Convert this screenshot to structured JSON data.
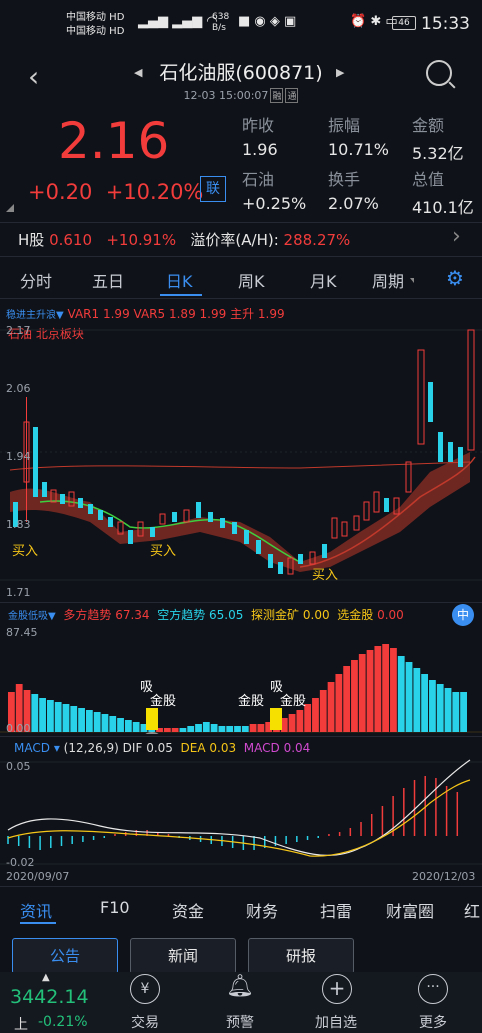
{
  "status": {
    "carrier1": "中国移动 HD",
    "carrier2": "中国移动 HD",
    "net_speed": "638",
    "net_unit": "B/s",
    "battery": "46",
    "time": "15:33"
  },
  "header": {
    "title": "石化油服(600871)",
    "subtitle": "12-03 15:00:07",
    "badge1": "融",
    "badge2": "通",
    "back_icon": "back-arrow-icon",
    "search_icon": "search-icon"
  },
  "quote": {
    "price": "2.16",
    "change": "+0.20",
    "change_pct": "+10.20%",
    "lian": "联",
    "prev_close_label": "昨收",
    "prev_close": "1.96",
    "amplitude_label": "振幅",
    "amplitude": "10.71%",
    "amount_label": "金额",
    "amount": "5.32亿",
    "sector_label": "石油",
    "sector_change": "+0.25%",
    "turnover_label": "换手",
    "turnover": "2.07%",
    "mktcap_label": "总值",
    "mktcap": "410.1亿",
    "h_label": "H股",
    "h_price": "0.610",
    "h_change": "+10.91%",
    "premium_label": "溢价率(A/H):",
    "premium": "288.27%"
  },
  "tabs": [
    "分时",
    "五日",
    "日K",
    "周K",
    "月K",
    "周期"
  ],
  "kline": {
    "legend_name": "稳进主升浪▼",
    "var1_label": "VAR1",
    "var1": "1.99",
    "var5_label": "VAR5",
    "var5": "1.89",
    "v3": "1.99",
    "zhusheng_label": "主升",
    "zhusheng": "1.99",
    "tags": "石油  北京板块",
    "y_top": "2.17",
    "y1": "2.06",
    "y2": "1.94",
    "y3": "1.83",
    "y_bottom": "1.71",
    "buy_label": "买入"
  },
  "ind2": {
    "name": "金股低吸▼",
    "long_label": "多方趋势",
    "long": "67.34",
    "short_label": "空方趋势",
    "short": "65.05",
    "probe_label": "探测金矿",
    "probe": "0.00",
    "select_label": "选金股",
    "select": "0.00",
    "y_top": "87.45",
    "y_bottom": "0.00",
    "xi": "吸",
    "jingu": "金股"
  },
  "macd": {
    "name": "MACD",
    "params": "(12,26,9)",
    "dif_label": "DIF",
    "dif": "0.05",
    "dea_label": "DEA",
    "dea": "0.03",
    "macd_label": "MACD",
    "macd": "0.04",
    "y_top": "0.05",
    "y_bottom": "-0.02",
    "date_start": "2020/09/07",
    "date_end": "2020/12/03"
  },
  "bottom_tabs": [
    "资讯",
    "F10",
    "资金",
    "财务",
    "扫雷",
    "财富圈",
    "红"
  ],
  "news_buttons": [
    "公告",
    "新闻",
    "研报"
  ],
  "footer": {
    "index_label": "上",
    "index_value": "3442.14",
    "index_change": "-0.21%",
    "items": [
      "交易",
      "预警",
      "加自选",
      "更多"
    ]
  }
}
